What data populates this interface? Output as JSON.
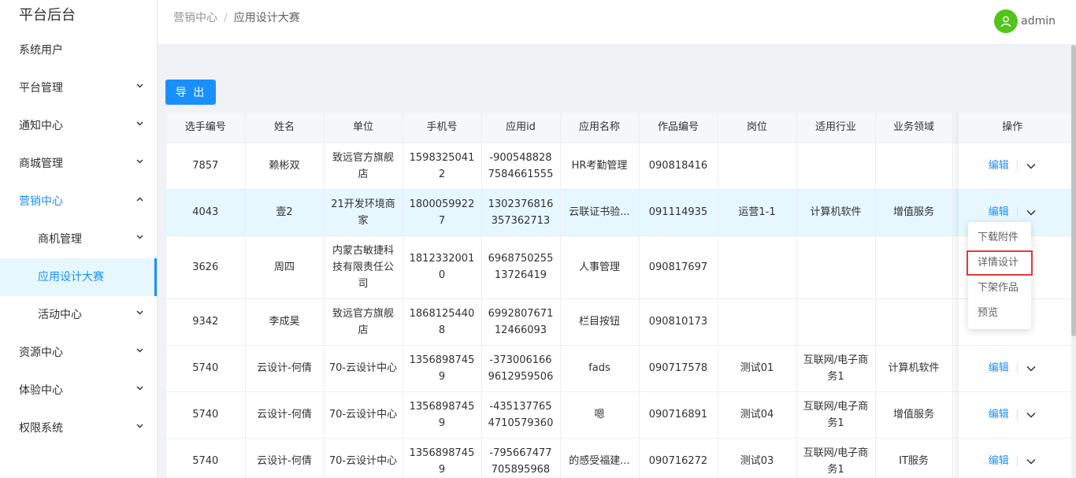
{
  "brand": "平台后台",
  "sidebar": {
    "items": [
      {
        "label": "系统用户"
      },
      {
        "label": "平台管理"
      },
      {
        "label": "通知中心"
      },
      {
        "label": "商城管理"
      },
      {
        "label": "营销中心"
      },
      {
        "label": "商机管理"
      },
      {
        "label": "应用设计大赛"
      },
      {
        "label": "活动中心"
      },
      {
        "label": "资源中心"
      },
      {
        "label": "体验中心"
      },
      {
        "label": "权限系统"
      }
    ]
  },
  "header": {
    "breadcrumb": [
      "营销中心",
      "/",
      "应用设计大赛"
    ],
    "user": "admin"
  },
  "toolbar": {
    "export_label": "导 出"
  },
  "table": {
    "columns": [
      "选手编号",
      "姓名",
      "单位",
      "手机号",
      "应用id",
      "应用名称",
      "作品编号",
      "岗位",
      "适用行业",
      "业务领域",
      "操作"
    ],
    "rows": [
      [
        "7857",
        "赖彬双",
        "致远官方旗舰店",
        "15983250412",
        "-9005488287584661555",
        "HR考勤管理",
        "090818416",
        "",
        "",
        ""
      ],
      [
        "4043",
        "壹2",
        "21开发环境商家",
        "18000599227",
        "1302376816357362713",
        "云联证书验...",
        "091114935",
        "运营1-1",
        "计算机软件",
        "增值服务"
      ],
      [
        "3626",
        "周四",
        "内蒙古敏捷科技有限责任公司",
        "18123320010",
        "696875025513726419",
        "人事管理",
        "090817697",
        "",
        "",
        ""
      ],
      [
        "9342",
        "李成昊",
        "致远官方旗舰店",
        "18681254408",
        "699280767112466093",
        "栏目按钮",
        "090810173",
        "",
        "",
        ""
      ],
      [
        "5740",
        "云设计-何倩",
        "70-云设计中心",
        "13568987459",
        "-3730061669612959506",
        "fads",
        "090717578",
        "测试01",
        "互联网/电子商务1",
        "计算机软件"
      ],
      [
        "5740",
        "云设计-何倩",
        "70-云设计中心",
        "13568987459",
        "-4351377654710579360",
        "嗯",
        "090716891",
        "测试04",
        "互联网/电子商务1",
        "增值服务"
      ],
      [
        "5740",
        "云设计-何倩",
        "70-云设计中心",
        "13568987459",
        "-795667477705895968",
        "的感受福建...",
        "090716272",
        "测试03",
        "互联网/电子商务1",
        "IT服务"
      ]
    ],
    "edit_label": "编辑"
  },
  "dropdown": {
    "items": [
      "下载附件",
      "详情设计",
      "下架作品",
      "预览"
    ]
  },
  "colors": {
    "accent": "#1890ff",
    "highlight_box": "#e53935",
    "avatar": "#52c41a"
  }
}
